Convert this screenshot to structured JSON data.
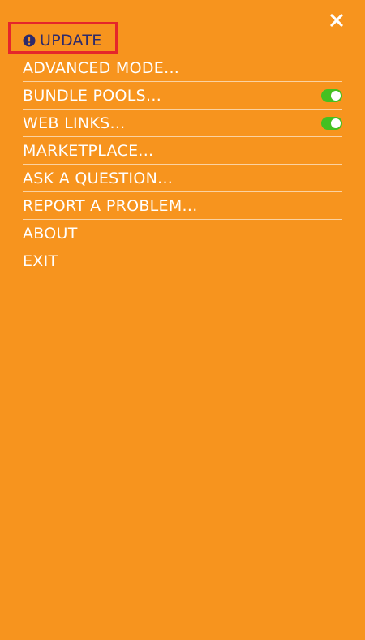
{
  "close": {
    "icon": "close-icon"
  },
  "menu": {
    "update": {
      "label": "UPDATE",
      "icon": "alert-circle-icon"
    },
    "items": [
      {
        "label": "ADVANCED MODE..."
      },
      {
        "label": "BUNDLE POOLS...",
        "toggle": {
          "on": true
        }
      },
      {
        "label": "WEB LINKS...",
        "toggle": {
          "on": true
        }
      },
      {
        "label": "MARKETPLACE..."
      },
      {
        "label": "ASK A QUESTION..."
      },
      {
        "label": "REPORT A PROBLEM..."
      },
      {
        "label": "ABOUT"
      },
      {
        "label": "EXIT"
      }
    ]
  },
  "colors": {
    "background": "#f7941e",
    "text": "#ffffff",
    "update_text": "#2e2a6b",
    "highlight": "#e5262a",
    "toggle_on": "#44c021"
  }
}
